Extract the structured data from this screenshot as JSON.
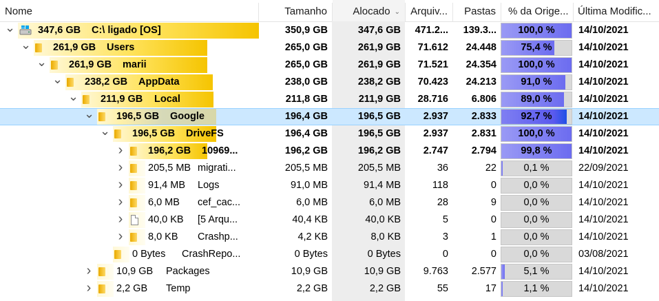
{
  "columns": {
    "name": "Nome",
    "size": "Tamanho",
    "allocated": "Alocado",
    "files": "Arquiv...",
    "folders": "Pastas",
    "percent": "% da Orige...",
    "modified": "Última Modific..."
  },
  "colors": {
    "size_bar_strong": "#f5c400",
    "size_bar_light": "#fff7cc",
    "percent_bar_blue": "#6c6cf0",
    "percent_bar_gray": "#d9d9d9",
    "selection": "#cce8ff"
  },
  "rows": [
    {
      "level": 0,
      "icon": "drive-icon",
      "expand": "expanded",
      "bold": true,
      "size_label": "347,6 GB",
      "name": "C:\\  ligado  [OS]",
      "size": "350,9 GB",
      "allocated": "347,6 GB",
      "files": "471.2...",
      "folders": "139.3...",
      "percent": "100,0 %",
      "percent_value": 100,
      "modified": "14/10/2021",
      "selected": false
    },
    {
      "level": 1,
      "icon": "folder-icon",
      "expand": "expanded",
      "bold": true,
      "size_label": "261,9 GB",
      "name": "Users",
      "size": "265,0 GB",
      "allocated": "261,9 GB",
      "files": "71.612",
      "folders": "24.448",
      "percent": "75,4 %",
      "percent_value": 75.4,
      "modified": "14/10/2021",
      "selected": false
    },
    {
      "level": 2,
      "icon": "folder-icon",
      "expand": "expanded",
      "bold": true,
      "size_label": "261,9 GB",
      "name": "marii",
      "size": "265,0 GB",
      "allocated": "261,9 GB",
      "files": "71.521",
      "folders": "24.354",
      "percent": "100,0 %",
      "percent_value": 100,
      "modified": "14/10/2021",
      "selected": false
    },
    {
      "level": 3,
      "icon": "folder-icon",
      "expand": "expanded",
      "bold": true,
      "size_label": "238,2 GB",
      "name": "AppData",
      "size": "238,0 GB",
      "allocated": "238,2 GB",
      "files": "70.423",
      "folders": "24.213",
      "percent": "91,0 %",
      "percent_value": 91,
      "modified": "14/10/2021",
      "selected": false
    },
    {
      "level": 4,
      "icon": "folder-icon",
      "expand": "expanded",
      "bold": true,
      "size_label": "211,9 GB",
      "name": "Local",
      "size": "211,8 GB",
      "allocated": "211,9 GB",
      "files": "28.716",
      "folders": "6.806",
      "percent": "89,0 %",
      "percent_value": 89,
      "modified": "14/10/2021",
      "selected": false
    },
    {
      "level": 5,
      "icon": "folder-icon",
      "expand": "expanded",
      "bold": true,
      "size_label": "196,5 GB",
      "name": "Google",
      "size": "196,4 GB",
      "allocated": "196,5 GB",
      "files": "2.937",
      "folders": "2.833",
      "percent": "92,7 %",
      "percent_value": 92.7,
      "modified": "14/10/2021",
      "selected": true
    },
    {
      "level": 6,
      "icon": "folder-icon",
      "expand": "expanded",
      "bold": true,
      "size_label": "196,5 GB",
      "name": "DriveFS",
      "size": "196,4 GB",
      "allocated": "196,5 GB",
      "files": "2.937",
      "folders": "2.831",
      "percent": "100,0 %",
      "percent_value": 100,
      "modified": "14/10/2021",
      "selected": false
    },
    {
      "level": 7,
      "icon": "folder-icon",
      "expand": "collapsed",
      "bold": true,
      "size_label": "196,2 GB",
      "name": "10969...",
      "size": "196,2 GB",
      "allocated": "196,2 GB",
      "files": "2.747",
      "folders": "2.794",
      "percent": "99,8 %",
      "percent_value": 99.8,
      "modified": "14/10/2021",
      "selected": false
    },
    {
      "level": 7,
      "icon": "folder-icon",
      "expand": "collapsed",
      "bold": false,
      "size_label": "205,5 MB",
      "name": "migrati...",
      "size": "205,5 MB",
      "allocated": "205,5 MB",
      "files": "36",
      "folders": "22",
      "percent": "0,1 %",
      "percent_value": 0.1,
      "modified": "22/09/2021",
      "selected": false
    },
    {
      "level": 7,
      "icon": "folder-icon",
      "expand": "collapsed",
      "bold": false,
      "size_label": "91,4 MB",
      "name": "Logs",
      "size": "91,0 MB",
      "allocated": "91,4 MB",
      "files": "118",
      "folders": "0",
      "percent": "0,0 %",
      "percent_value": 0,
      "modified": "14/10/2021",
      "selected": false
    },
    {
      "level": 7,
      "icon": "folder-icon",
      "expand": "collapsed",
      "bold": false,
      "size_label": "6,0 MB",
      "name": "cef_cac...",
      "size": "6,0 MB",
      "allocated": "6,0 MB",
      "files": "28",
      "folders": "9",
      "percent": "0,0 %",
      "percent_value": 0,
      "modified": "14/10/2021",
      "selected": false
    },
    {
      "level": 7,
      "icon": "file-icon",
      "expand": "collapsed",
      "bold": false,
      "size_label": "40,0 KB",
      "name": "[5 Arqu...",
      "size": "40,4 KB",
      "allocated": "40,0 KB",
      "files": "5",
      "folders": "0",
      "percent": "0,0 %",
      "percent_value": 0,
      "modified": "14/10/2021",
      "selected": false
    },
    {
      "level": 7,
      "icon": "folder-icon",
      "expand": "collapsed",
      "bold": false,
      "size_label": "8,0 KB",
      "name": "Crashp...",
      "size": "4,2 KB",
      "allocated": "8,0 KB",
      "files": "3",
      "folders": "1",
      "percent": "0,0 %",
      "percent_value": 0,
      "modified": "14/10/2021",
      "selected": false
    },
    {
      "level": 6,
      "icon": "folder-icon",
      "expand": "none",
      "bold": false,
      "size_label": "0 Bytes",
      "name": "CrashRepo...",
      "size": "0 Bytes",
      "allocated": "0 Bytes",
      "files": "0",
      "folders": "0",
      "percent": "0,0 %",
      "percent_value": 0,
      "modified": "03/08/2021",
      "selected": false
    },
    {
      "level": 5,
      "icon": "folder-icon",
      "expand": "collapsed",
      "bold": false,
      "size_label": "10,9 GB",
      "name": "Packages",
      "size": "10,9 GB",
      "allocated": "10,9 GB",
      "files": "9.763",
      "folders": "2.577",
      "percent": "5,1 %",
      "percent_value": 5.1,
      "modified": "14/10/2021",
      "selected": false
    },
    {
      "level": 5,
      "icon": "folder-icon",
      "expand": "collapsed",
      "bold": false,
      "size_label": "2,2 GB",
      "name": "Temp",
      "size": "2,2 GB",
      "allocated": "2,2 GB",
      "files": "55",
      "folders": "17",
      "percent": "1,1 %",
      "percent_value": 1.1,
      "modified": "14/10/2021",
      "selected": false
    }
  ]
}
